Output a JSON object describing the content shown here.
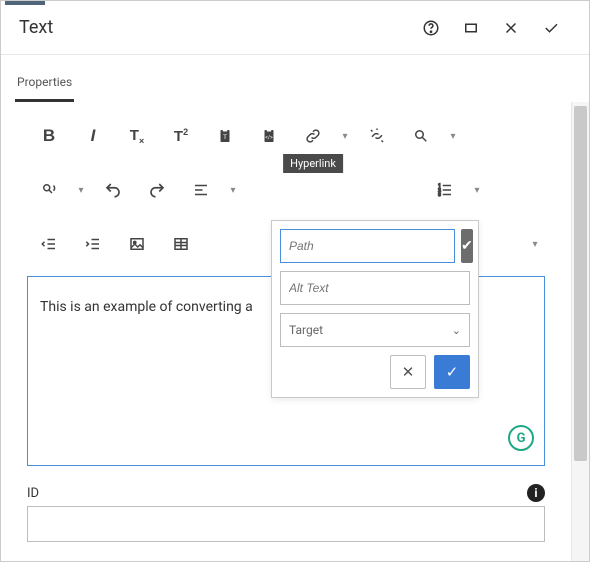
{
  "header": {
    "title": "Text",
    "help_icon": "help-circle",
    "fullscreen_icon": "fullscreen",
    "close_icon": "close",
    "confirm_icon": "check"
  },
  "tabs": {
    "active": "Properties"
  },
  "toolbar": {
    "row1": [
      "bold",
      "italic",
      "text-style",
      "superscript",
      "paste-text",
      "paste-html",
      "hyperlink",
      "unlink",
      "find"
    ],
    "row2": [
      "replace",
      "undo",
      "redo",
      "align",
      "outdent",
      "indent",
      "numbered-list"
    ],
    "row3": [
      "outdent2",
      "indent2",
      "image",
      "table"
    ],
    "tooltip": "Hyperlink"
  },
  "editor": {
    "content": "This is an example of converting a",
    "grammarly_badge": "G"
  },
  "popover": {
    "path_placeholder": "Path",
    "alt_placeholder": "Alt Text",
    "target_label": "Target",
    "confirm_checkbox": "✓",
    "cancel": "✕",
    "apply": "✓"
  },
  "fields": {
    "id": {
      "label": "ID",
      "value": ""
    }
  },
  "colors": {
    "accent": "#3a7bd5",
    "border_focus": "#4a90d9",
    "badge": "#1ea884"
  }
}
